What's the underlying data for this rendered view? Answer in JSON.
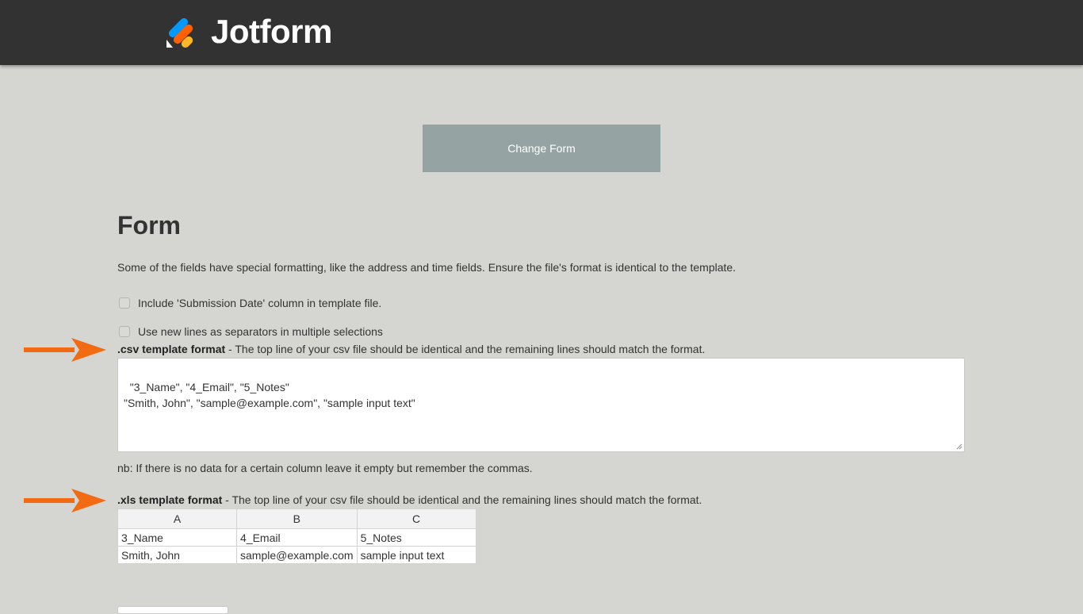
{
  "header": {
    "brand": "Jotform",
    "logo_colors": [
      "#0a1551",
      "#ffb629",
      "#ff6100",
      "#0099ff"
    ]
  },
  "change_form_button": "Change Form",
  "form": {
    "title": "Form",
    "intro": "Some of the fields have special formatting, like the address and time fields. Ensure the file's format is identical to the template.",
    "options": [
      "Include 'Submission Date' column in template file.",
      "Use new lines as separators in multiple selections"
    ],
    "csv": {
      "label_bold": ".csv template format",
      "label_rest": " - The top line of your csv file should be identical and the remaining lines should match the format.",
      "content": "\"3_Name\", \"4_Email\", \"5_Notes\"\n\"Smith, John\", \"sample@example.com\", \"sample input text\""
    },
    "nb": "nb: If there is no data for a certain column leave it empty but remember the commas.",
    "xls": {
      "label_bold": ".xls template format",
      "label_rest": " - The top line of your csv file should be identical and the remaining lines should match the format.",
      "columns": [
        "A",
        "B",
        "C"
      ],
      "rows": [
        [
          "3_Name",
          "4_Email",
          "5_Notes"
        ],
        [
          "Smith, John",
          "sample@example.com",
          "sample input text"
        ]
      ]
    }
  },
  "annotation_arrow_color": "#f26a12"
}
